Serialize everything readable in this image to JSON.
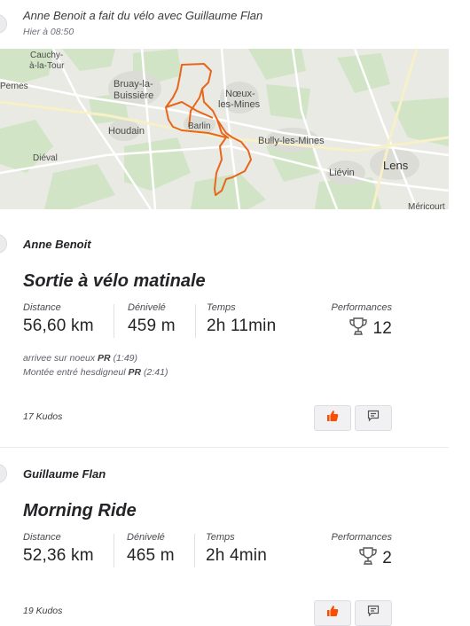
{
  "header": {
    "title": "Anne Benoit a fait du vélo avec Guillaume Flan",
    "time": "Hier à 08:50"
  },
  "map": {
    "labels": [
      "Cauchy-",
      "à-la-Tour",
      "Pernes",
      "Bruay-la-",
      "Buissière",
      "Nœux-",
      "les-Mines",
      "Houdain",
      "Barlin",
      "Bully-les-Mines",
      "Diéval",
      "Liévin",
      "Lens",
      "Méricourt"
    ],
    "route_color": "#e8661b",
    "land_color": "#e9eae4",
    "green_color": "#d2e4c6"
  },
  "activities": [
    {
      "athlete": "Anne Benoit",
      "title": "Sortie à vélo matinale",
      "distance_label": "Distance",
      "distance": "56,60 km",
      "elevation_label": "Dénivelé",
      "elevation": "459 m",
      "time_label": "Temps",
      "time": "2h 11min",
      "performances_label": "Performances",
      "performances": "12",
      "achievements": [
        {
          "segment": "arrivee sur noeux",
          "tag": "PR",
          "time": "(1:49)"
        },
        {
          "segment": "Montée entré hesdigneul",
          "tag": "PR",
          "time": "(2:41)"
        }
      ],
      "kudos": "17 Kudos",
      "kudos_active": true
    },
    {
      "athlete": "Guillaume Flan",
      "title": "Morning Ride",
      "distance_label": "Distance",
      "distance": "52,36 km",
      "elevation_label": "Dénivelé",
      "elevation": "465 m",
      "time_label": "Temps",
      "time": "2h 4min",
      "performances_label": "Performances",
      "performances": "2",
      "kudos": "19 Kudos",
      "kudos_active": true
    }
  ],
  "colors": {
    "accent": "#fc4c02",
    "text": "#242428",
    "muted": "#6d6d78"
  }
}
